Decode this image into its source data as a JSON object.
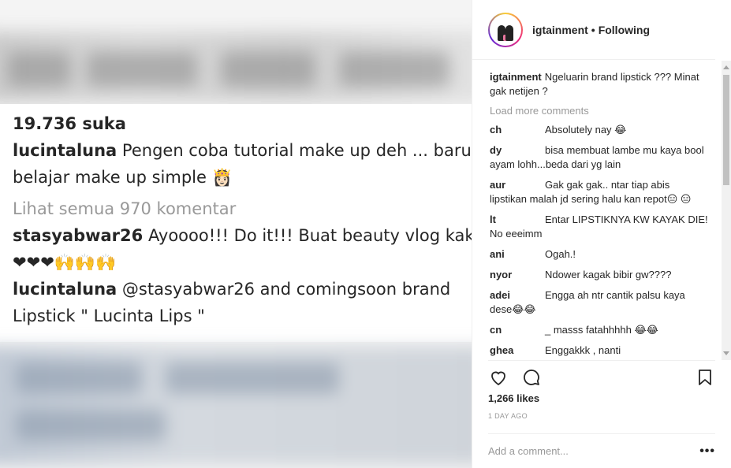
{
  "photo": {
    "likes_text": "19.736 suka",
    "caption_user": "lucintaluna",
    "caption_text_1": "Pengen coba tutorial make up deh ... baru",
    "caption_text_2": "belajar make up simple 👸🏻",
    "view_all": "Lihat semua 970 komentar",
    "c1_user": "stasyabwar26",
    "c1_text_1": "Ayoooo!!! Do it!!! Buat beauty vlog kak",
    "c1_text_2": "❤❤❤🙌🙌🙌",
    "c2_user": "lucintaluna",
    "c2_text_1": "@stasyabwar26 and comingsoon brand",
    "c2_text_2": "Lipstick \" Lucinta Lips \""
  },
  "header": {
    "username": "igtainment",
    "separator": "•",
    "follow_status": "Following"
  },
  "caption": {
    "user": "igtainment",
    "text": "Ngeluarin brand lipstick ??? Minat gak netijen ?"
  },
  "load_more": "Load more comments",
  "comments": [
    {
      "user": "ch",
      "text": "Absolutely nay 😂"
    },
    {
      "user": "dy",
      "text": "bisa membuat lambe mu kaya bool ayam lohh...beda dari yg lain"
    },
    {
      "user": "aur",
      "text": "Gak gak gak.. ntar tiap abis lipstikan malah jd sering halu kan repot😑 😑"
    },
    {
      "user": "lt",
      "text": "Entar LIPSTIKNYA KW KAYAK DIE! No eeeimm"
    },
    {
      "user": "ani",
      "text": "Ogah.!"
    },
    {
      "user": "nyor",
      "text": "Ndower kagak bibir gw????"
    },
    {
      "user": "adei",
      "text": "Engga ah ntr cantik palsu kaya dese😂😂"
    },
    {
      "user": "cn",
      "text": "_ masss fatahhhhh 😂😂"
    },
    {
      "user": "ghea",
      "text": "Enggakkk , nanti"
    }
  ],
  "likes": "1,266 likes",
  "time_ago": "1 DAY AGO",
  "add_comment": {
    "placeholder": "Add a comment..."
  },
  "more_options": "•••",
  "icons": {
    "like": "heart-icon",
    "comment": "comment-icon",
    "save": "bookmark-icon"
  }
}
